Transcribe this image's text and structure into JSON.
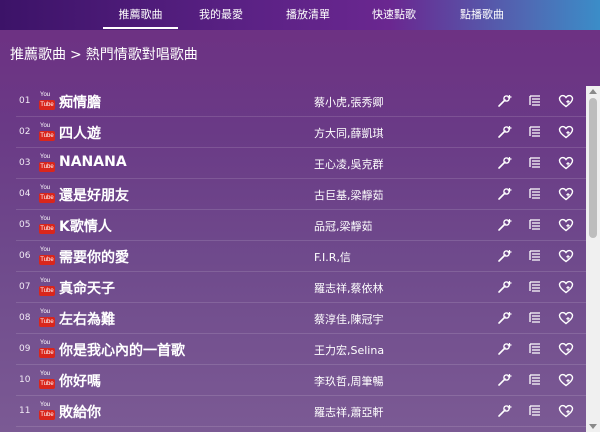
{
  "nav": {
    "tabs": [
      {
        "label": "推薦歌曲",
        "active": true
      },
      {
        "label": "我的最愛",
        "active": false
      },
      {
        "label": "播放清單",
        "active": false
      },
      {
        "label": "快速點歌",
        "active": false
      },
      {
        "label": "點播歌曲",
        "active": false
      }
    ]
  },
  "breadcrumb": {
    "root": "推薦歌曲",
    "separator": ">",
    "current": "熱門情歌對唱歌曲"
  },
  "youtube_badge": {
    "top": "You",
    "bottom": "Tube"
  },
  "songs": [
    {
      "num": "01",
      "title": "痴情膽",
      "artist": "蔡小虎,張秀卿"
    },
    {
      "num": "02",
      "title": "四人遊",
      "artist": "方大同,薛凱琪"
    },
    {
      "num": "03",
      "title": "NANANA",
      "artist": "王心凌,吳克群"
    },
    {
      "num": "04",
      "title": "還是好朋友",
      "artist": "古巨基,梁靜茹"
    },
    {
      "num": "05",
      "title": "K歌情人",
      "artist": "品冠,梁靜茹"
    },
    {
      "num": "06",
      "title": "需要你的愛",
      "artist": "F.I.R,信"
    },
    {
      "num": "07",
      "title": "真命天子",
      "artist": "羅志祥,蔡依林"
    },
    {
      "num": "08",
      "title": "左右為難",
      "artist": "蔡淳佳,陳冠宇"
    },
    {
      "num": "09",
      "title": "你是我心內的一首歌",
      "artist": "王力宏,Selina"
    },
    {
      "num": "10",
      "title": "你好嗎",
      "artist": "李玖哲,周筆暢"
    },
    {
      "num": "11",
      "title": "敗給你",
      "artist": "羅志祥,蕭亞軒"
    }
  ],
  "row_actions": [
    "add-song-icon",
    "playlist-icon",
    "favorite-heart-icon"
  ],
  "colors": {
    "youtube_red": "#d9261c",
    "accent": "#ffffff"
  }
}
